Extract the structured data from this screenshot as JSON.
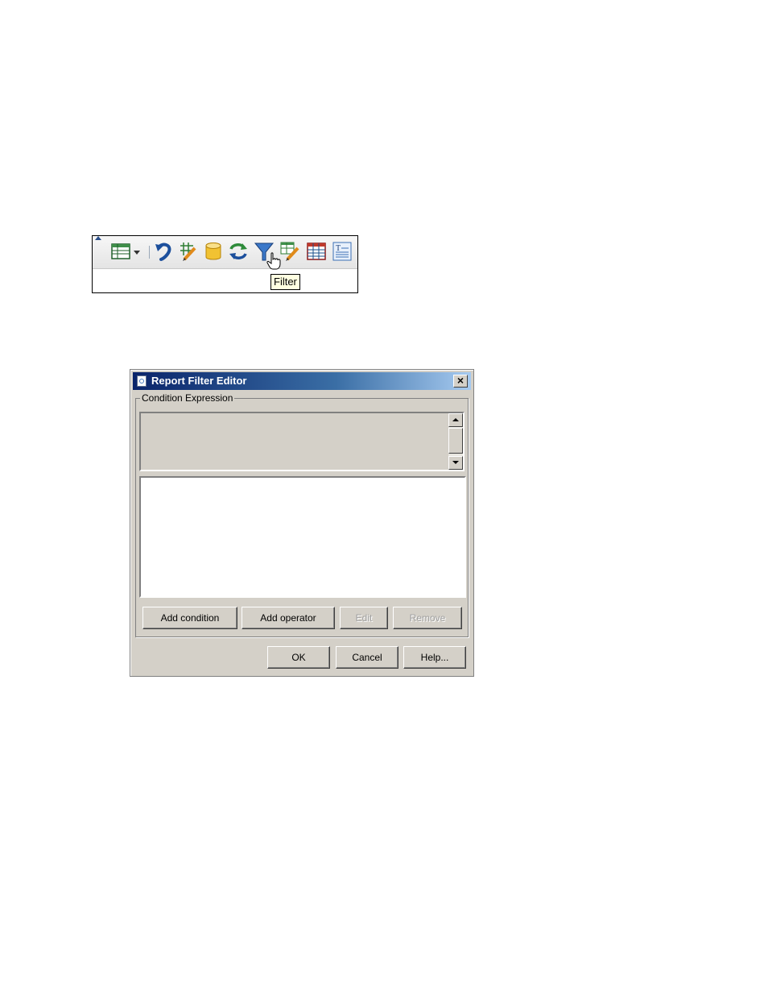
{
  "toolbar": {
    "icons": [
      "table-icon",
      "dropdown-arrow-icon",
      "undo-icon",
      "edit-grid-icon",
      "database-icon",
      "refresh-icon",
      "filter-icon",
      "edit-table-icon",
      "table-grid-icon",
      "text-icon"
    ],
    "tooltip": "Filter",
    "pointer": "hand-cursor-icon"
  },
  "dialog": {
    "title": "Report Filter Editor",
    "close_label": "×",
    "group_label": "Condition Expression",
    "buttons": {
      "add_condition": "Add condition",
      "add_operator": "Add operator",
      "edit": "Edit",
      "remove": "Remove",
      "ok": "OK",
      "cancel": "Cancel",
      "help": "Help..."
    },
    "disabled_buttons": [
      "edit",
      "remove"
    ]
  },
  "colors": {
    "titlebar_start": "#0a246a",
    "titlebar_end": "#a6caf0",
    "dialog_bg": "#d4d0c8",
    "tooltip_bg": "#ffffe1"
  }
}
